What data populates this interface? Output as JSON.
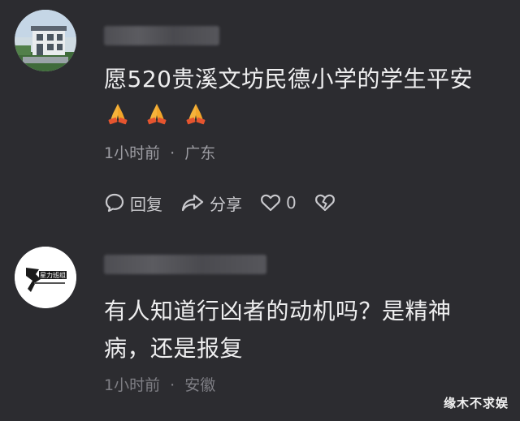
{
  "comments": [
    {
      "text": "愿520贵溪文坊民德小学的学生平安",
      "emoji": "pray-emoji",
      "time": "1小时前",
      "location": "广东",
      "actions": {
        "reply": "回复",
        "share": "分享",
        "like_count": "0"
      }
    },
    {
      "text_line1": "有人知道行凶者的动机吗？是精神",
      "text_line2": "病，还是报复",
      "time": "1小时前",
      "location": "安徽",
      "avatar_text": "星力班组"
    }
  ],
  "meta_separator": "·",
  "watermark": "缘木不求娱"
}
